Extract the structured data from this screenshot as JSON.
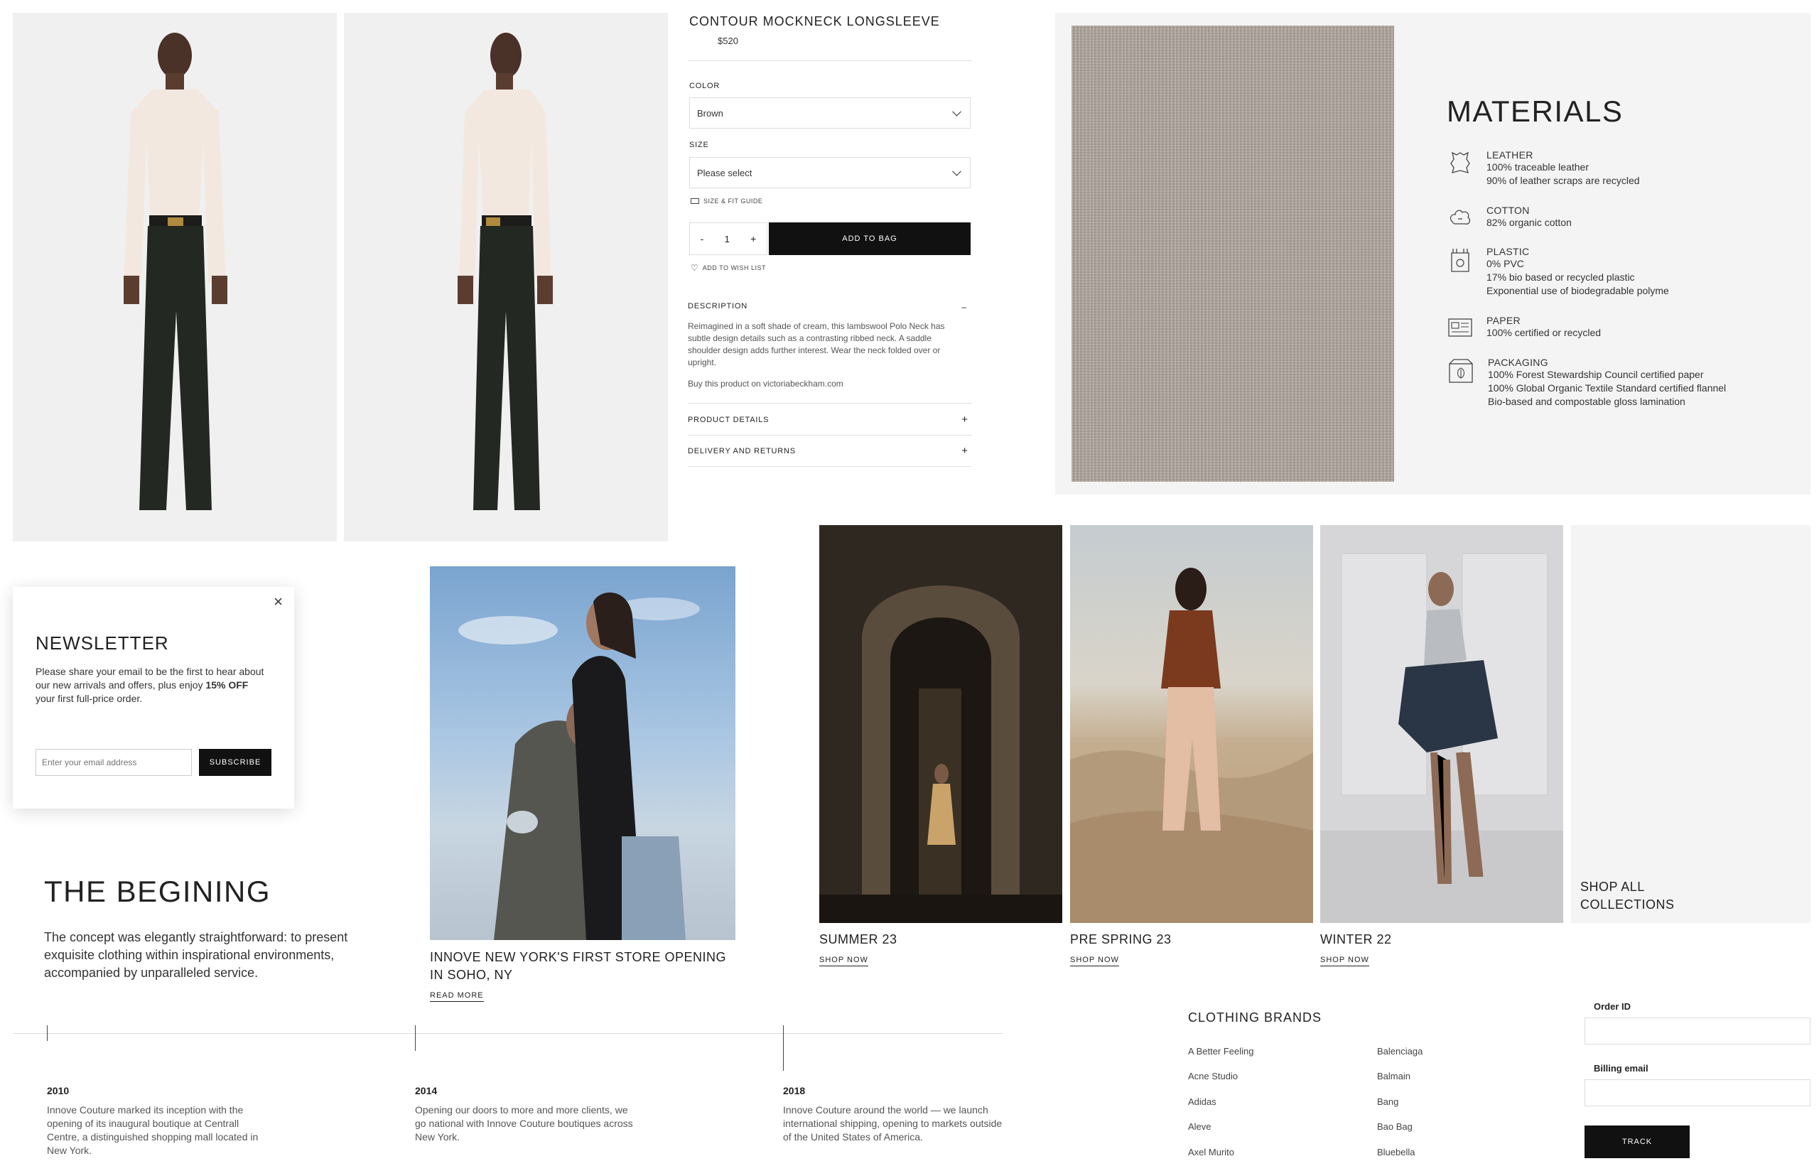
{
  "product": {
    "title": "CONTOUR MOCKNECK LONGSLEEVE",
    "price": "$520",
    "color_label": "COLOR",
    "color_value": "Brown",
    "size_label": "SIZE",
    "size_value": "Please select",
    "size_guide": "SIZE & FIT GUIDE",
    "quantity": "1",
    "qty_minus": "-",
    "qty_plus": "+",
    "add_to_bag": "ADD TO BAG",
    "wishlist": "ADD TO WISH LIST",
    "description_label": "DESCRIPTION",
    "description_toggle": "–",
    "description_text": "Reimagined in a soft shade of cream, this lambswool Polo Neck has subtle design details such as a contrasting ribbed neck. A saddle shoulder design adds further interest. Wear the neck folded over or upright.",
    "buy_link": "Buy this product on victoriabeckham.com",
    "product_details_label": "PRODUCT DETAILS",
    "delivery_label": "DELIVERY AND RETURNS",
    "expand_symbol": "+"
  },
  "materials": {
    "title": "MATERIALS",
    "items": [
      {
        "name": "LEATHER",
        "icon": "leather-icon",
        "lines": [
          "100% traceable leather",
          "90% of leather scraps are recycled"
        ]
      },
      {
        "name": "COTTON",
        "icon": "cotton-icon",
        "lines": [
          "82% organic cotton"
        ]
      },
      {
        "name": "PLASTIC",
        "icon": "plastic-icon",
        "lines": [
          "0% PVC",
          "17% bio based or recycled plastic",
          "Exponential use of biodegradable polyme"
        ]
      },
      {
        "name": "PAPER",
        "icon": "paper-icon",
        "lines": [
          "100% certified or recycled"
        ]
      },
      {
        "name": "PACKAGING",
        "icon": "packaging-icon",
        "lines": [
          "100% Forest Stewardship Council certified paper",
          "100% Global Organic Textile Standard certified flannel",
          "Bio-based and compostable gloss lamination"
        ]
      }
    ]
  },
  "newsletter": {
    "title": "NEWSLETTER",
    "text_before": "Please share your email to be the first to hear about our new arrivals and offers, plus enjoy ",
    "text_bold": "15% OFF",
    "text_after": " your first full-price order.",
    "email_placeholder": "Enter your email address",
    "subscribe": "SUBSCRIBE"
  },
  "story": {
    "title": "THE BEGINING",
    "text": "The concept was elegantly straightforward: to present exquisite clothing within inspirational environments, accompanied by unparalleled service."
  },
  "feature": {
    "title": "INNOVE NEW YORK'S FIRST STORE OPENING IN SOHO, NY",
    "link": "READ MORE"
  },
  "collections": [
    {
      "title": "SUMMER 23",
      "link": "SHOP NOW"
    },
    {
      "title": "PRE SPRING 23",
      "link": "SHOP NOW"
    },
    {
      "title": "WINTER 22",
      "link": "SHOP NOW"
    }
  ],
  "shop_all": "SHOP ALL COLLECTIONS",
  "timeline": [
    {
      "year": "2010",
      "text": "Innove Couture marked its inception with the opening of its inaugural boutique at Centrall Centre, a distinguished shopping mall located in New York."
    },
    {
      "year": "2014",
      "text": "Opening our doors to more and more clients, we go national with Innove Couture boutiques across New York."
    },
    {
      "year": "2018",
      "text": "Innove Couture around the world — we launch international shipping, opening to markets outside of the United States of America."
    }
  ],
  "brands": {
    "title": "CLOTHING BRANDS",
    "col1": [
      "A Better Feeling",
      "Acne Studio",
      "Adidas",
      "Aleve",
      "Axel Murito"
    ],
    "col2": [
      "Balenciaga",
      "Balmain",
      "Bang",
      "Bao Bag",
      "Bluebella"
    ]
  },
  "track": {
    "order_label": "Order ID",
    "email_label": "Billing email",
    "button": "TRACK"
  }
}
